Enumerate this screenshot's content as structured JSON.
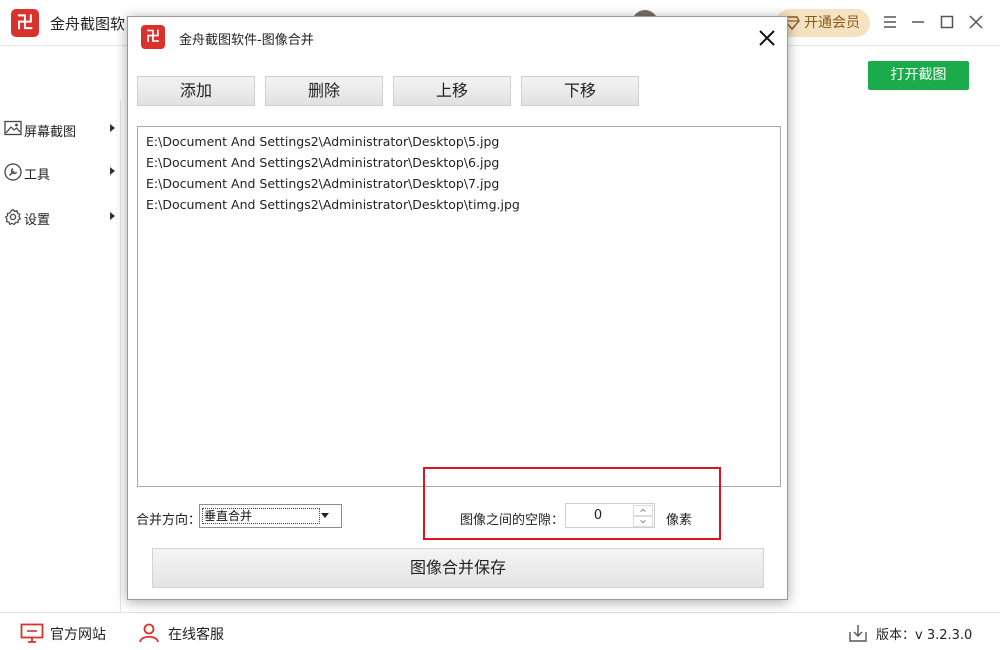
{
  "app": {
    "title": "金舟截图软",
    "logo_text": "卍",
    "vip_label": "开通会员",
    "open_capture_label": "打开截图"
  },
  "sidebar": {
    "items": [
      {
        "label": "屏幕截图",
        "icon": "image-icon"
      },
      {
        "label": "工具",
        "icon": "wrench-icon"
      },
      {
        "label": "设置",
        "icon": "gear-icon"
      }
    ]
  },
  "footer": {
    "website_label": "官方网站",
    "service_label": "在线客服",
    "version_label": "版本：v 3.2.3.0"
  },
  "dialog": {
    "title": "金舟截图软件-图像合并",
    "logo_text": "卍",
    "buttons": {
      "add": "添加",
      "delete": "删除",
      "move_up": "上移",
      "move_down": "下移"
    },
    "files": [
      "E:\\Document And Settings2\\Administrator\\Desktop\\5.jpg",
      "E:\\Document And Settings2\\Administrator\\Desktop\\6.jpg",
      "E:\\Document And Settings2\\Administrator\\Desktop\\7.jpg",
      "E:\\Document And Settings2\\Administrator\\Desktop\\timg.jpg"
    ],
    "direction_label": "合并方向：",
    "direction_value": "垂直合并",
    "gap_label": "图像之间的空隙：",
    "gap_value": "0",
    "gap_unit": "像素",
    "save_label": "图像合并保存"
  },
  "colors": {
    "brand_red": "#d9322c",
    "green_button": "#1aab4a",
    "highlight_red": "#d9161a",
    "vip_bg": "#f5e2c0"
  }
}
